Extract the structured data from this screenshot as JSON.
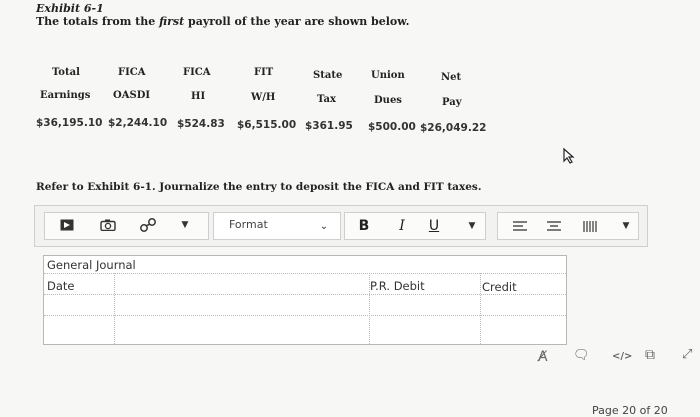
{
  "exhibit": {
    "title": "Exhibit 6-1",
    "subtitle_pre": "The totals from the ",
    "subtitle_em": "first",
    "subtitle_post": " payroll of the year are shown below."
  },
  "table": {
    "headers_row1": [
      "Total",
      "FICA",
      "FICA",
      "FIT",
      "State",
      "Union",
      "Net"
    ],
    "headers_row2": [
      "Earnings",
      "OASDI",
      "HI",
      "W/H",
      "Tax",
      "Dues",
      "Pay"
    ],
    "values": [
      "$36,195.10",
      "$2,244.10",
      "$524.83",
      "$6,515.00",
      "$361.95",
      "$500.00",
      "$26,049.22"
    ]
  },
  "question": "Refer to Exhibit 6-1. Journalize the entry to deposit the FICA and FIT taxes.",
  "toolbar": {
    "format_label": "Format",
    "bold": "B",
    "italic": "I",
    "underline": "U"
  },
  "journal": {
    "title": "General Journal",
    "col_date": "Date",
    "col_pr_debit": "P.R. Debit",
    "col_credit": "Credit"
  },
  "pager": "Page 20 of 20",
  "colors": {
    "text": "#222222",
    "border": "#cfcfcf",
    "background": "#f7f7f5"
  }
}
